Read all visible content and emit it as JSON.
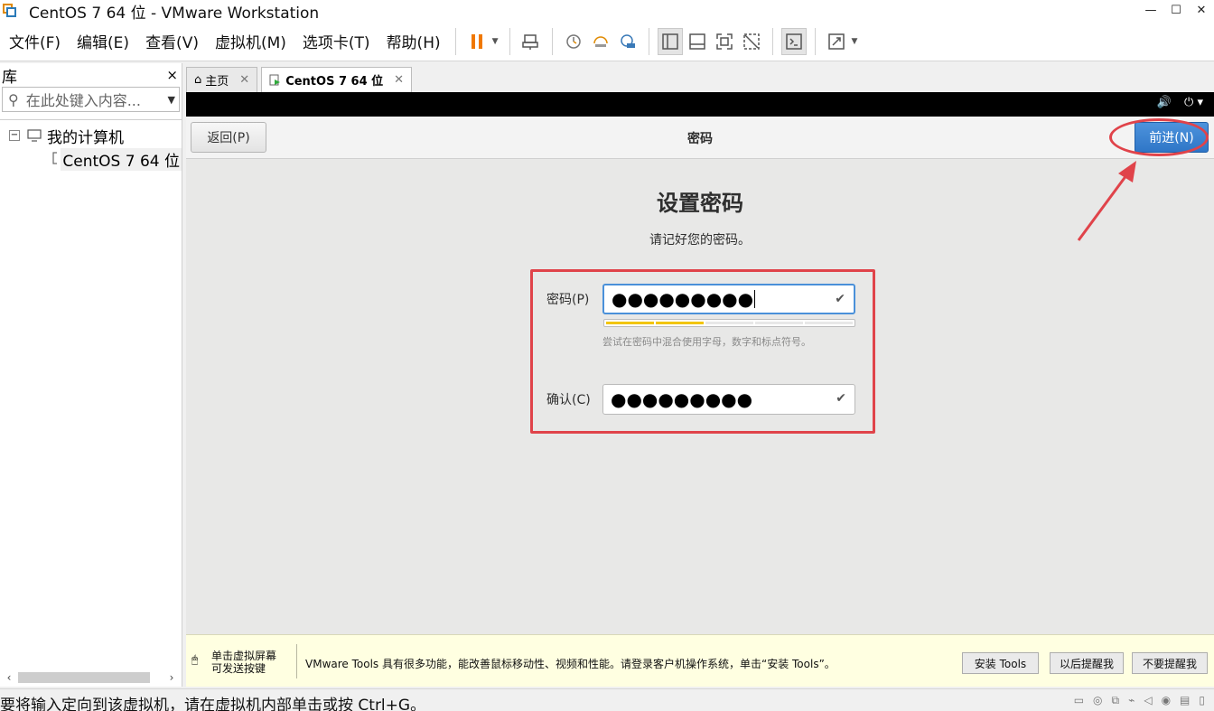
{
  "window": {
    "title": "CentOS 7 64 位 - VMware Workstation",
    "controls": {
      "minimize": "—",
      "maximize": "☐",
      "close": "✕"
    }
  },
  "menu": [
    "文件(F)",
    "编辑(E)",
    "查看(V)",
    "虚拟机(M)",
    "选项卡(T)",
    "帮助(H)"
  ],
  "library": {
    "title": "库",
    "close": "×",
    "search_placeholder": "在此处键入内容...",
    "tree": {
      "root": "我的计算机",
      "root_toggle": "−",
      "child": "CentOS 7 64 位"
    }
  },
  "tabs": [
    {
      "label": "主页",
      "close": "✕"
    },
    {
      "label": "CentOS 7 64 位",
      "close": "✕"
    }
  ],
  "vm": {
    "back_label": "返回(P)",
    "header_title": "密码",
    "next_label": "前进(N)",
    "heading": "设置密码",
    "subheading": "请记好您的密码。",
    "password_label": "密码(P)",
    "password_mask": "●●●●●●●●●",
    "password_strength": 0.4,
    "hint": "尝试在密码中混合使用字母，数字和标点符号。",
    "confirm_label": "确认(C)",
    "confirm_mask": "●●●●●●●●●",
    "check_glyph": "✔"
  },
  "tools_bar": {
    "left_text_line1": "单击虚拟屏幕",
    "left_text_line2": "可发送按键",
    "message": "VMware Tools 具有很多功能，能改善鼠标移动性、视频和性能。请登录客户机操作系统，单击“安装 Tools”。",
    "install_label": "安装 Tools",
    "remind_label": "以后提醒我",
    "never_label": "不要提醒我"
  },
  "status": {
    "message": "要将输入定向到该虚拟机，请在虚拟机内部单击或按 Ctrl+G。"
  },
  "colors": {
    "accent_blue": "#2f76c7",
    "annotation_red": "#e0434a",
    "strength_yellow": "#f2c500",
    "tools_bg": "#ffffe1",
    "pause_orange": "#f07800"
  }
}
